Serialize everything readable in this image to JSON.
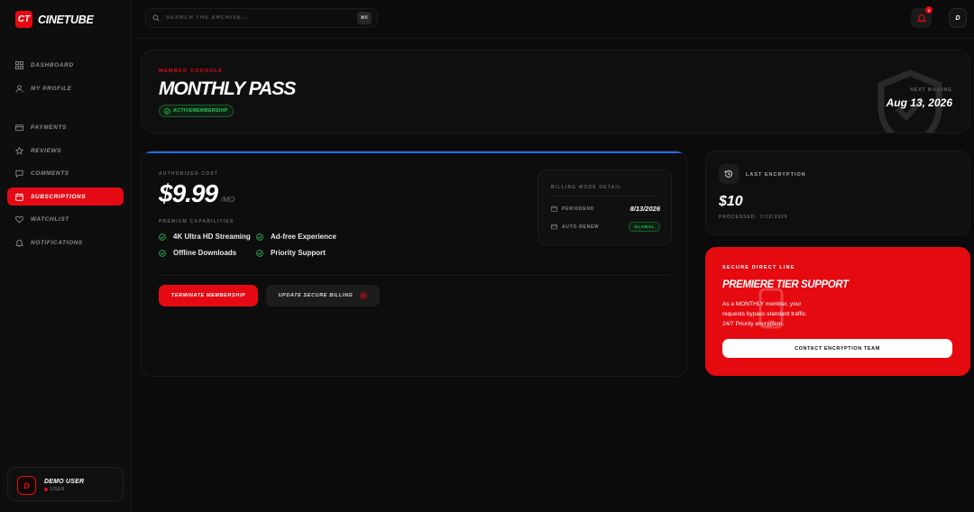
{
  "brand": {
    "logo": "CT",
    "name": "CINETUBE"
  },
  "sidebar": {
    "items": [
      {
        "label": "DASHBOARD",
        "icon": "dashboard-icon",
        "active": false
      },
      {
        "label": "MY PROFILE",
        "icon": "user-icon",
        "active": false
      },
      {
        "label": "PAYMENTS",
        "icon": "card-icon",
        "active": false
      },
      {
        "label": "REVIEWS",
        "icon": "star-icon",
        "active": false
      },
      {
        "label": "COMMENTS",
        "icon": "comment-icon",
        "active": false
      },
      {
        "label": "SUBSCRIPTIONS",
        "icon": "calendar-icon",
        "active": true
      },
      {
        "label": "WATCHLIST",
        "icon": "heart-icon",
        "active": false
      },
      {
        "label": "NOTIFICATIONS",
        "icon": "bell-icon",
        "active": false
      }
    ],
    "user": {
      "initial": "D",
      "name": "DEMO USER",
      "status": "USER"
    }
  },
  "header": {
    "search_placeholder": "SEARCH THE ARCHIVE...",
    "shortcut": "⌘K",
    "notification_count": "1",
    "avatar_initial": "D"
  },
  "hero": {
    "eyebrow": "MEMBER CONSOLE",
    "title": "MONTHLY PASS",
    "status": "ACTIVEMEMBERSHIP",
    "next_label": "NEXT BILLING",
    "next_date": "Aug 13, 2026"
  },
  "plan": {
    "cost_label": "AUTHORIZED COST",
    "cost": "$9.99",
    "per": "/MO",
    "capabilities_label": "PREMIUM CAPABILITIES",
    "features": [
      "4K Ultra HD Streaming",
      "Ad-free Experience",
      "Offline Downloads",
      "Priority Support"
    ],
    "terminate_label": "TERMINATE MEMBERSHIP",
    "update_label": "UPDATE SECURE BILLING",
    "billing_mode": {
      "label": "BILLING MODE DETAIL",
      "period_key": "PERIODEND",
      "period_val": "8/13/2026",
      "renew_key": "AUTO-RENEW",
      "renew_val": "GLOBAL"
    }
  },
  "encryption": {
    "label": "LAST ENCRYPTION",
    "amount": "$10",
    "processed": "PROCESSED: 7/12/2026"
  },
  "support": {
    "eyebrow": "SECURE DIRECT LINE",
    "title": "PREMIERE TIER SUPPORT",
    "body_1": "As a MONTHLY member, your",
    "body_2": "requests bypass standard traffic.",
    "body_3": "24/7 Priority encryption.",
    "button": "CONTACT ENCRYPTION TEAM"
  },
  "colors": {
    "accent": "#e50914",
    "success": "#2fc25b",
    "info": "#1f6feb",
    "background": "#0b0b0b"
  }
}
